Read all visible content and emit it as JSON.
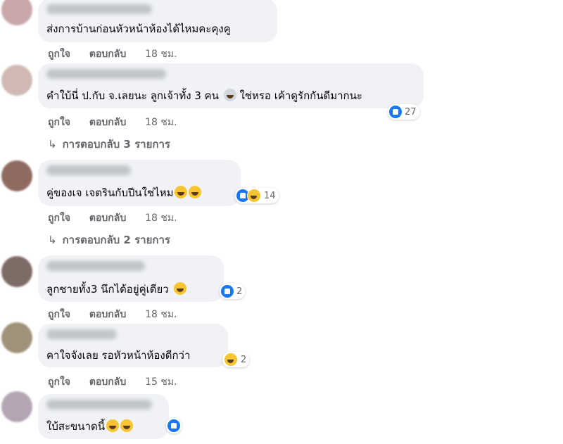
{
  "comments": [
    {
      "text": "ส่งการบ้านก่อนหัวหน้าห้องได้ไหมคะคุงคู",
      "like": "ถูกใจ",
      "reply": "ตอบกลับ",
      "time": "18 ชม."
    },
    {
      "text": "คำใบ้นี่ ป.กับ จ.เลยนะ ลูกเจ้าทั้ง 3 คน",
      "text2": "ใช่หรอ เค้าดูรักกันดีมากนะ",
      "reaction_count": "27",
      "like": "ถูกใจ",
      "reply": "ตอบกลับ",
      "time": "18 ชม.",
      "replies": "การตอบกลับ 3 รายการ"
    },
    {
      "text": "คู่ของเจ เจตรินกับปีนใช่ไหม",
      "reaction_count": "14",
      "like": "ถูกใจ",
      "reply": "ตอบกลับ",
      "time": "18 ชม.",
      "replies": "การตอบกลับ 2 รายการ"
    },
    {
      "text": "ลูกชายทั้ง3 นึกได้อยู่คู่เดียว",
      "reaction_count": "2",
      "like": "ถูกใจ",
      "reply": "ตอบกลับ",
      "time": "18 ชม."
    },
    {
      "text": "คาใจจังเลย รอหัวหน้าห้องดีกว่า",
      "reaction_count": "2",
      "like": "ถูกใจ",
      "reply": "ตอบกลับ",
      "time": "15 ชม."
    },
    {
      "text": "ใบ้สะขนาดนี้"
    }
  ],
  "icons": {
    "like": "like-reaction-icon",
    "haha": "haha-reaction-icon",
    "reply_arrow": "reply-arrow-icon"
  },
  "colors": {
    "bubble": "#f0f2f5",
    "secondary_text": "#65676b",
    "like_blue": "#1877f2"
  }
}
